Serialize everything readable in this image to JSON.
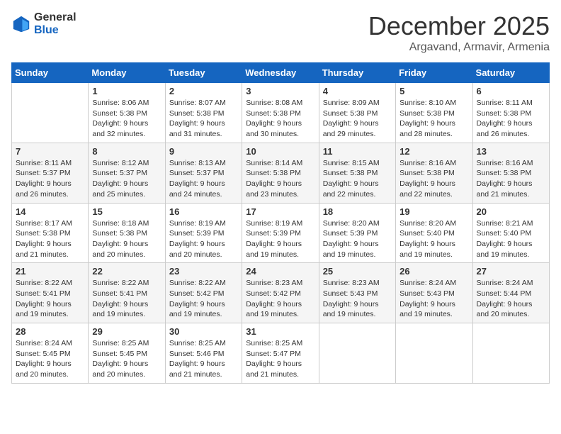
{
  "logo": {
    "general": "General",
    "blue": "Blue"
  },
  "title": {
    "month_year": "December 2025",
    "location": "Argavand, Armavir, Armenia"
  },
  "days_of_week": [
    "Sunday",
    "Monday",
    "Tuesday",
    "Wednesday",
    "Thursday",
    "Friday",
    "Saturday"
  ],
  "weeks": [
    [
      {
        "day": "",
        "info": ""
      },
      {
        "day": "1",
        "info": "Sunrise: 8:06 AM\nSunset: 5:38 PM\nDaylight: 9 hours\nand 32 minutes."
      },
      {
        "day": "2",
        "info": "Sunrise: 8:07 AM\nSunset: 5:38 PM\nDaylight: 9 hours\nand 31 minutes."
      },
      {
        "day": "3",
        "info": "Sunrise: 8:08 AM\nSunset: 5:38 PM\nDaylight: 9 hours\nand 30 minutes."
      },
      {
        "day": "4",
        "info": "Sunrise: 8:09 AM\nSunset: 5:38 PM\nDaylight: 9 hours\nand 29 minutes."
      },
      {
        "day": "5",
        "info": "Sunrise: 8:10 AM\nSunset: 5:38 PM\nDaylight: 9 hours\nand 28 minutes."
      },
      {
        "day": "6",
        "info": "Sunrise: 8:11 AM\nSunset: 5:38 PM\nDaylight: 9 hours\nand 26 minutes."
      }
    ],
    [
      {
        "day": "7",
        "info": "Sunrise: 8:11 AM\nSunset: 5:37 PM\nDaylight: 9 hours\nand 26 minutes."
      },
      {
        "day": "8",
        "info": "Sunrise: 8:12 AM\nSunset: 5:37 PM\nDaylight: 9 hours\nand 25 minutes."
      },
      {
        "day": "9",
        "info": "Sunrise: 8:13 AM\nSunset: 5:37 PM\nDaylight: 9 hours\nand 24 minutes."
      },
      {
        "day": "10",
        "info": "Sunrise: 8:14 AM\nSunset: 5:38 PM\nDaylight: 9 hours\nand 23 minutes."
      },
      {
        "day": "11",
        "info": "Sunrise: 8:15 AM\nSunset: 5:38 PM\nDaylight: 9 hours\nand 22 minutes."
      },
      {
        "day": "12",
        "info": "Sunrise: 8:16 AM\nSunset: 5:38 PM\nDaylight: 9 hours\nand 22 minutes."
      },
      {
        "day": "13",
        "info": "Sunrise: 8:16 AM\nSunset: 5:38 PM\nDaylight: 9 hours\nand 21 minutes."
      }
    ],
    [
      {
        "day": "14",
        "info": "Sunrise: 8:17 AM\nSunset: 5:38 PM\nDaylight: 9 hours\nand 21 minutes."
      },
      {
        "day": "15",
        "info": "Sunrise: 8:18 AM\nSunset: 5:38 PM\nDaylight: 9 hours\nand 20 minutes."
      },
      {
        "day": "16",
        "info": "Sunrise: 8:19 AM\nSunset: 5:39 PM\nDaylight: 9 hours\nand 20 minutes."
      },
      {
        "day": "17",
        "info": "Sunrise: 8:19 AM\nSunset: 5:39 PM\nDaylight: 9 hours\nand 19 minutes."
      },
      {
        "day": "18",
        "info": "Sunrise: 8:20 AM\nSunset: 5:39 PM\nDaylight: 9 hours\nand 19 minutes."
      },
      {
        "day": "19",
        "info": "Sunrise: 8:20 AM\nSunset: 5:40 PM\nDaylight: 9 hours\nand 19 minutes."
      },
      {
        "day": "20",
        "info": "Sunrise: 8:21 AM\nSunset: 5:40 PM\nDaylight: 9 hours\nand 19 minutes."
      }
    ],
    [
      {
        "day": "21",
        "info": "Sunrise: 8:22 AM\nSunset: 5:41 PM\nDaylight: 9 hours\nand 19 minutes."
      },
      {
        "day": "22",
        "info": "Sunrise: 8:22 AM\nSunset: 5:41 PM\nDaylight: 9 hours\nand 19 minutes."
      },
      {
        "day": "23",
        "info": "Sunrise: 8:22 AM\nSunset: 5:42 PM\nDaylight: 9 hours\nand 19 minutes."
      },
      {
        "day": "24",
        "info": "Sunrise: 8:23 AM\nSunset: 5:42 PM\nDaylight: 9 hours\nand 19 minutes."
      },
      {
        "day": "25",
        "info": "Sunrise: 8:23 AM\nSunset: 5:43 PM\nDaylight: 9 hours\nand 19 minutes."
      },
      {
        "day": "26",
        "info": "Sunrise: 8:24 AM\nSunset: 5:43 PM\nDaylight: 9 hours\nand 19 minutes."
      },
      {
        "day": "27",
        "info": "Sunrise: 8:24 AM\nSunset: 5:44 PM\nDaylight: 9 hours\nand 20 minutes."
      }
    ],
    [
      {
        "day": "28",
        "info": "Sunrise: 8:24 AM\nSunset: 5:45 PM\nDaylight: 9 hours\nand 20 minutes."
      },
      {
        "day": "29",
        "info": "Sunrise: 8:25 AM\nSunset: 5:45 PM\nDaylight: 9 hours\nand 20 minutes."
      },
      {
        "day": "30",
        "info": "Sunrise: 8:25 AM\nSunset: 5:46 PM\nDaylight: 9 hours\nand 21 minutes."
      },
      {
        "day": "31",
        "info": "Sunrise: 8:25 AM\nSunset: 5:47 PM\nDaylight: 9 hours\nand 21 minutes."
      },
      {
        "day": "",
        "info": ""
      },
      {
        "day": "",
        "info": ""
      },
      {
        "day": "",
        "info": ""
      }
    ]
  ]
}
